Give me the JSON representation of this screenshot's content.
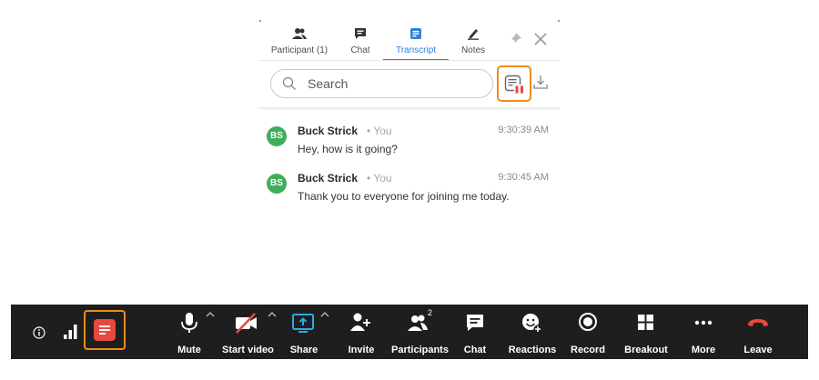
{
  "panel": {
    "tabs": [
      {
        "label": "Participant (1)",
        "icon": "participants-icon"
      },
      {
        "label": "Chat",
        "icon": "chat-icon"
      },
      {
        "label": "Transcript",
        "icon": "transcript-icon",
        "active": true
      },
      {
        "label": "Notes",
        "icon": "notes-icon"
      }
    ],
    "search": {
      "placeholder": "Search"
    },
    "messages": [
      {
        "initials": "BS",
        "sender": "Buck Strick",
        "you_tag": "• You",
        "time": "9:30:39 AM",
        "text": "Hey, how is it going?"
      },
      {
        "initials": "BS",
        "sender": "Buck Strick",
        "you_tag": "• You",
        "time": "9:30:45 AM",
        "text": "Thank you to everyone for joining me today."
      }
    ]
  },
  "toolbar": {
    "participant_count": "2",
    "items": [
      {
        "label": "Mute",
        "icon": "microphone-icon"
      },
      {
        "label": "Start video",
        "icon": "video-off-icon"
      },
      {
        "label": "Share",
        "icon": "share-screen-icon"
      },
      {
        "label": "Invite",
        "icon": "invite-icon"
      },
      {
        "label": "Participants",
        "icon": "participants-icon"
      },
      {
        "label": "Chat",
        "icon": "chat-icon"
      },
      {
        "label": "Reactions",
        "icon": "reactions-icon"
      },
      {
        "label": "Record",
        "icon": "record-icon"
      },
      {
        "label": "Breakout",
        "icon": "breakout-icon"
      },
      {
        "label": "More",
        "icon": "more-icon"
      },
      {
        "label": "Leave",
        "icon": "leave-icon"
      }
    ]
  },
  "colors": {
    "accent": "#2f7fd9",
    "highlight": "#f08c1a",
    "avatar": "#3fae5a",
    "leave": "#e8483f",
    "toolbar_bg": "#1e1e1e"
  }
}
